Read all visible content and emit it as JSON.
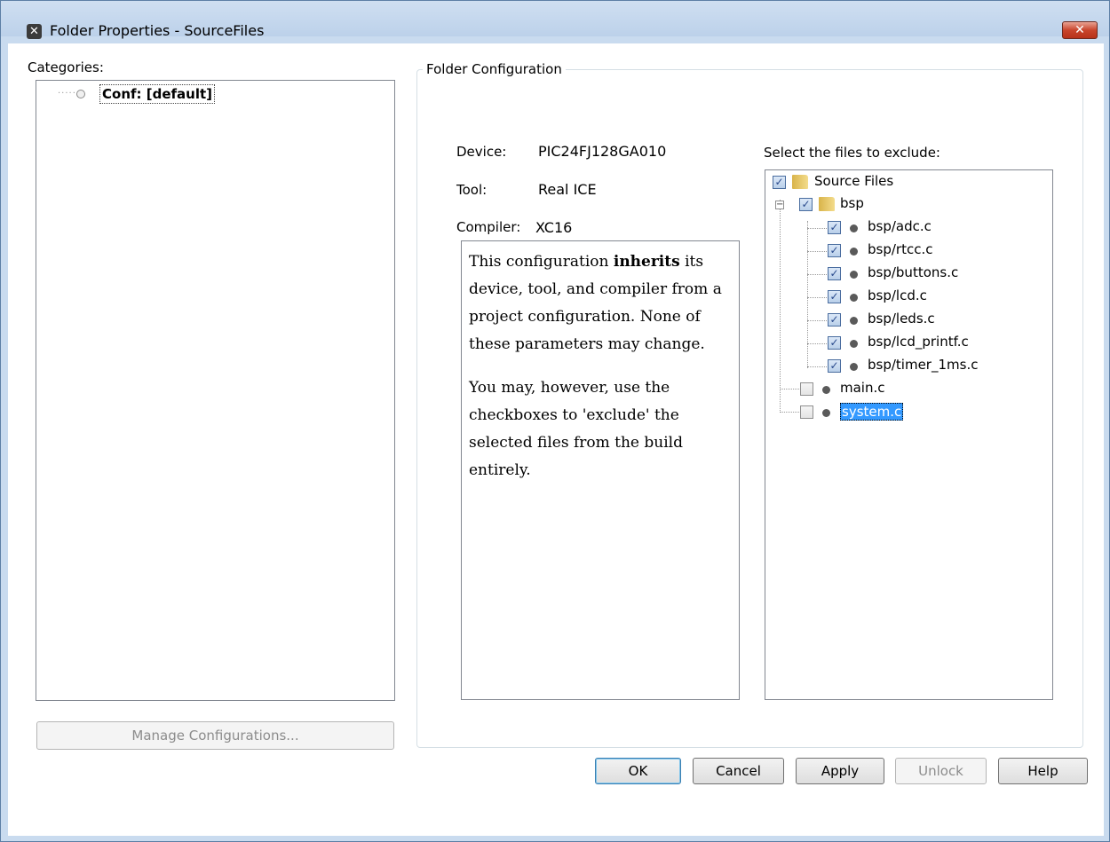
{
  "window": {
    "title": "Folder Properties - SourceFiles",
    "close_glyph": "✕"
  },
  "categories": {
    "label": "Categories:",
    "items": [
      {
        "label": "Conf: [default]"
      }
    ],
    "manage_button": "Manage Configurations..."
  },
  "folder_config": {
    "legend": "Folder Configuration",
    "device_label": "Device:",
    "device_value": "PIC24FJ128GA010",
    "tool_label": "Tool:",
    "tool_value": "Real ICE",
    "compiler_label": "Compiler:",
    "compiler_value": "XC16",
    "info_p1_before": "This configuration ",
    "info_p1_bold": "inherits",
    "info_p1_after": " its device, tool, and compiler from a project configuration. None of these parameters may change.",
    "info_p2": "You may, however, use the checkboxes to 'exclude' the selected files from the build entirely."
  },
  "exclude": {
    "label": "Select the files to exclude:",
    "tree": [
      {
        "name": "Source Files",
        "checked": true,
        "kind": "folder"
      },
      {
        "name": "bsp",
        "checked": true,
        "kind": "folder",
        "expanded": true
      },
      {
        "name": "bsp/adc.c",
        "checked": true,
        "kind": "file"
      },
      {
        "name": "bsp/rtcc.c",
        "checked": true,
        "kind": "file"
      },
      {
        "name": "bsp/buttons.c",
        "checked": true,
        "kind": "file"
      },
      {
        "name": "bsp/lcd.c",
        "checked": true,
        "kind": "file"
      },
      {
        "name": "bsp/leds.c",
        "checked": true,
        "kind": "file"
      },
      {
        "name": "bsp/lcd_printf.c",
        "checked": true,
        "kind": "file"
      },
      {
        "name": "bsp/timer_1ms.c",
        "checked": true,
        "kind": "file"
      },
      {
        "name": "main.c",
        "checked": false,
        "kind": "file"
      },
      {
        "name": "system.c",
        "checked": false,
        "kind": "file",
        "selected": true
      }
    ]
  },
  "buttons": {
    "ok": "OK",
    "cancel": "Cancel",
    "apply": "Apply",
    "unlock": "Unlock",
    "help": "Help"
  },
  "colors": {
    "selection": "#3399ff",
    "titlebar": "#c9dbef",
    "close_button": "#c9452c"
  }
}
